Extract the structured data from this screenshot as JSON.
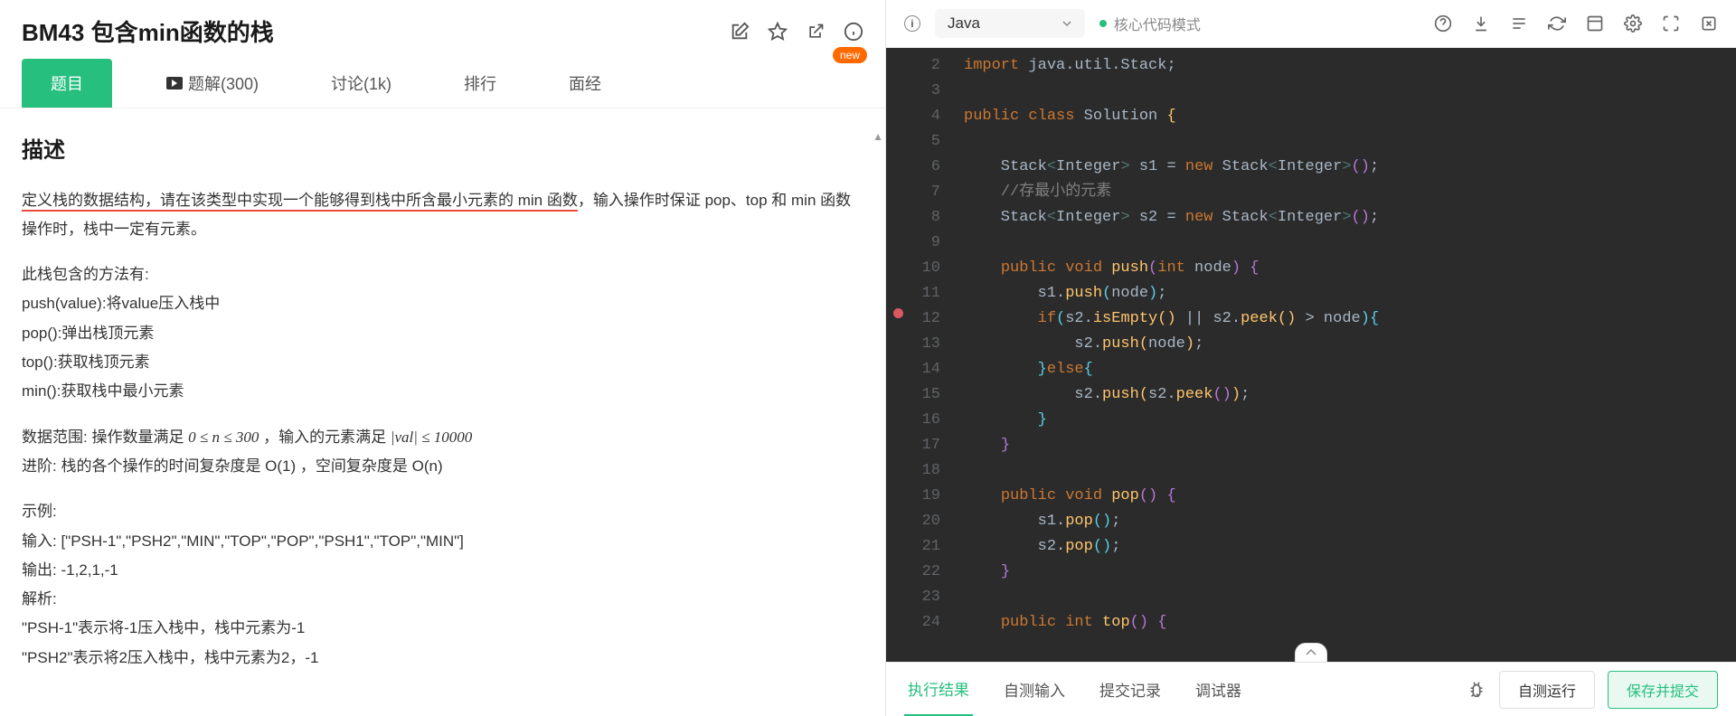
{
  "title": "BM43  包含min函数的栈",
  "newBadge": "new",
  "tabs": {
    "problem": "题目",
    "solution": "题解(300)",
    "discuss": "讨论(1k)",
    "ranking": "排行",
    "interview": "面经"
  },
  "description": {
    "heading": "描述",
    "line1_pre": "定义栈的数据结构，请在该类型中",
    "line1_underlined": "实现一个能够得到栈中所含最小元素的 min 函数",
    "line1_post": "，输入操作时保证 pop、top 和 min 函数操作时，栈中一定有元素。",
    "methods_intro": "此栈包含的方法有:",
    "m_push": "push(value):将value压入栈中",
    "m_pop": "pop():弹出栈顶元素",
    "m_top": "top():获取栈顶元素",
    "m_min": "min():获取栈中最小元素",
    "range_label": "数据范围: 操作数量满足 ",
    "range_n": "0 ≤ n ≤ 300",
    "range_middle": "  ，输入的元素满足 ",
    "range_val": "|val| ≤ 10000",
    "advance": "进阶:  栈的各个操作的时间复杂度是 O(1)   ，空间复杂度是 O(n)",
    "example_label": "示例:",
    "input_label": "输入:    ",
    "input_val": "[\"PSH-1\",\"PSH2\",\"MIN\",\"TOP\",\"POP\",\"PSH1\",\"TOP\",\"MIN\"]",
    "output_label": "输出:    ",
    "output_val": "-1,2,1,-1",
    "parse_label": "解析:",
    "parse1": "\"PSH-1\"表示将-1压入栈中，栈中元素为-1",
    "parse2": "\"PSH2\"表示将2压入栈中，栈中元素为2，-1"
  },
  "editor": {
    "language": "Java",
    "mode": "核心代码模式",
    "lines_start": 2,
    "lines_end": 24
  },
  "footer": {
    "result": "执行结果",
    "selftest_input": "自测输入",
    "submit_history": "提交记录",
    "debugger": "调试器",
    "selftest_run": "自测运行",
    "save_submit": "保存并提交"
  }
}
